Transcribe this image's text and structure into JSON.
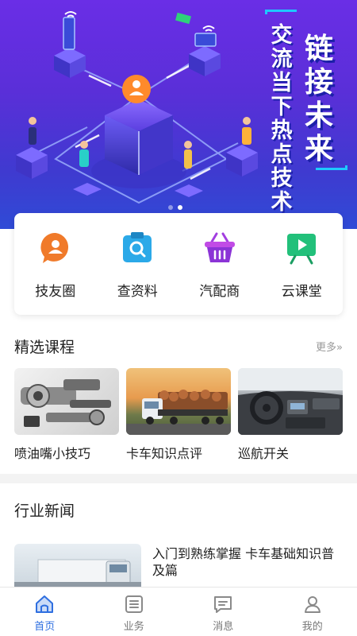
{
  "banner": {
    "slogan_col_a": "交流当下热点技术",
    "slogan_col_b": "链接未来",
    "dots": 2,
    "active_dot": 1
  },
  "quick_menu": [
    {
      "label": "技友圈",
      "icon": "chat-user-icon",
      "color": "#f07a2a"
    },
    {
      "label": "查资料",
      "icon": "search-doc-icon",
      "color": "#2ba9e8"
    },
    {
      "label": "汽配商",
      "icon": "basket-icon",
      "color": "#a23ee0"
    },
    {
      "label": "云课堂",
      "icon": "video-board-icon",
      "color": "#22c07a"
    }
  ],
  "courses": {
    "title": "精选课程",
    "more": "更多»",
    "items": [
      {
        "caption": "喷油嘴小技巧",
        "image": "injector-parts-image"
      },
      {
        "caption": "卡车知识点评",
        "image": "truck-logs-image"
      },
      {
        "caption": "巡航开关",
        "image": "truck-dashboard-image"
      }
    ]
  },
  "news": {
    "title": "行业新闻",
    "items": [
      {
        "title": "入门到熟练掌握 卡车基础知识普及篇",
        "image": "truck-news-image"
      }
    ]
  },
  "tabbar": {
    "items": [
      {
        "label": "首页",
        "icon": "home-icon",
        "active": true
      },
      {
        "label": "业务",
        "icon": "list-icon",
        "active": false
      },
      {
        "label": "消息",
        "icon": "message-icon",
        "active": false
      },
      {
        "label": "我的",
        "icon": "user-icon",
        "active": false
      }
    ],
    "active_color": "#2f6fe0"
  }
}
